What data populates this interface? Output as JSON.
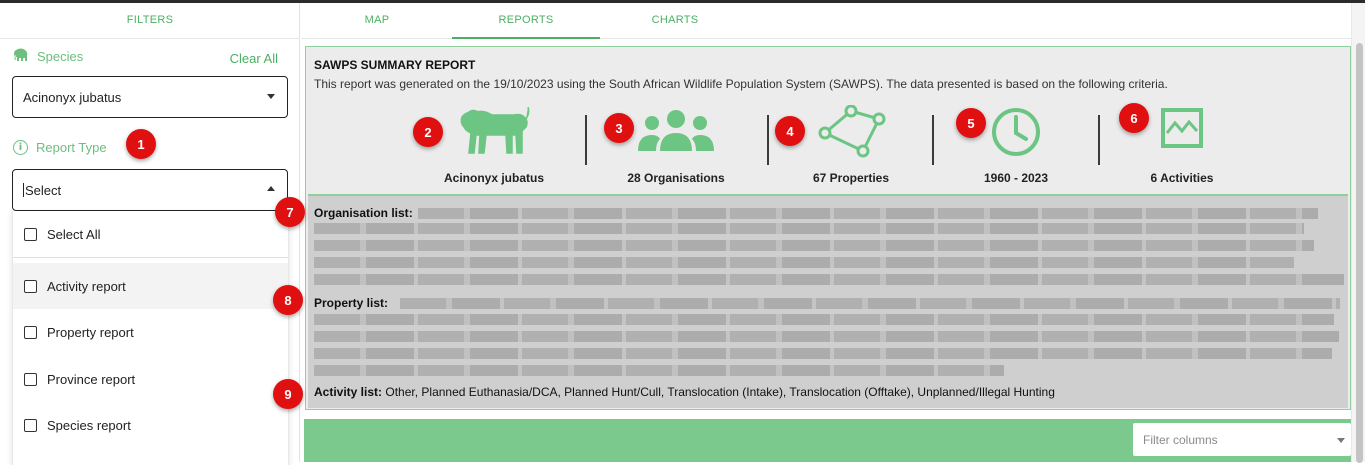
{
  "sidebar": {
    "tab": "FILTERS",
    "species_label": "Species",
    "clear_all": "Clear All",
    "species_value": "Acinonyx jubatus",
    "report_type_label": "Report Type",
    "report_select_placeholder": "Select",
    "options": [
      "Select All",
      "Activity report",
      "Property report",
      "Province report",
      "Species report"
    ]
  },
  "tabs": [
    "MAP",
    "REPORTS",
    "CHARTS"
  ],
  "active_tab": "REPORTS",
  "report": {
    "title": "SAWPS SUMMARY REPORT",
    "description": "This report was generated on the 19/10/2023 using the South African Wildlife Population System (SAWPS). The data presented is based on the following criteria.",
    "stats": [
      {
        "label": "Acinonyx jubatus",
        "icon": "cheetah-icon"
      },
      {
        "label": "28 Organisations",
        "icon": "people-group-icon"
      },
      {
        "label": "67 Properties",
        "icon": "property-polygon-icon"
      },
      {
        "label": "1960 - 2023",
        "icon": "clock-icon"
      },
      {
        "label": "6 Activities",
        "icon": "activity-chart-icon"
      }
    ],
    "organisation_list_label": "Organisation list",
    "property_list_label": "Property list",
    "activity_list_label": "Activity list",
    "activity_list": "Other, Planned Euthanasia/DCA, Planned Hunt/Cull, Translocation (Intake), Translocation (Offtake), Unplanned/Illegal Hunting"
  },
  "badges": [
    "1",
    "2",
    "3",
    "4",
    "5",
    "6",
    "7",
    "8",
    "9"
  ],
  "filter_columns_placeholder": "Filter columns",
  "colors": {
    "accent": "#4caf63",
    "accent_light": "#7bc98d",
    "badge": "#e01010",
    "panel": "#ececec"
  }
}
